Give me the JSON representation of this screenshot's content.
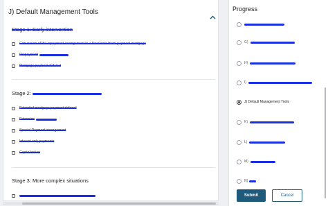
{
  "panel": {
    "title": "J) Default Management Tools"
  },
  "stages": [
    {
      "title": "Stage 1: Early intervention",
      "items": [
        "Conversion of the repayment arrangement to a fixed instalment payment mortgage",
        "Prepayment",
        "Mortgage payment deferral"
      ]
    },
    {
      "title": "Stage 2:",
      "items": [
        "Extended mortgage payment deferral",
        "Extension",
        "Special Payment arrangement",
        "Interest only payments",
        "Capitalization"
      ]
    },
    {
      "title": "Stage 3: More complex situations",
      "items": [
        ""
      ]
    }
  ],
  "progress": {
    "title": "Progress",
    "steps": [
      {
        "label": "",
        "active": false
      },
      {
        "label": "G)",
        "active": false
      },
      {
        "label": "H)",
        "active": false
      },
      {
        "label": "I)",
        "active": false
      },
      {
        "label": "J) Default Management Tools",
        "active": true
      },
      {
        "label": "K)",
        "active": false
      },
      {
        "label": "L)",
        "active": false
      },
      {
        "label": "M)",
        "active": false
      },
      {
        "label": "N)",
        "active": false
      }
    ]
  },
  "buttons": {
    "submit": "Submit",
    "cancel": "Cancel"
  },
  "colors": {
    "accent": "#1d5a7c",
    "redaction": "#1a2fe0"
  },
  "icons": {
    "collapse": "chevron-up-icon"
  }
}
